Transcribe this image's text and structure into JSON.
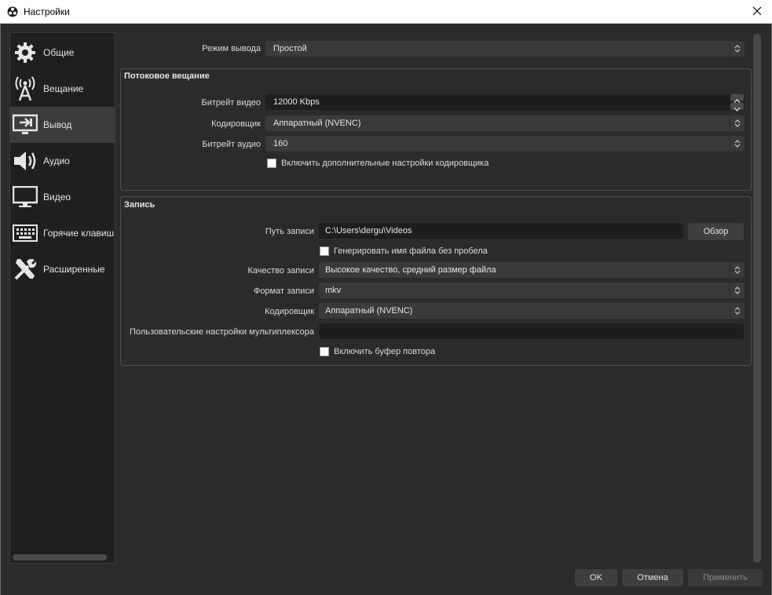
{
  "window": {
    "title": "Настройки"
  },
  "sidebar": {
    "items": [
      {
        "label": "Общие",
        "icon": "gear-icon"
      },
      {
        "label": "Вещание",
        "icon": "broadcast-icon"
      },
      {
        "label": "Вывод",
        "icon": "output-icon"
      },
      {
        "label": "Аудио",
        "icon": "speaker-icon"
      },
      {
        "label": "Видео",
        "icon": "monitor-icon"
      },
      {
        "label": "Горячие клавиш",
        "icon": "keyboard-icon"
      },
      {
        "label": "Расширенные",
        "icon": "tools-icon"
      }
    ],
    "active": "Вывод"
  },
  "output_mode": {
    "label": "Режим вывода",
    "value": "Простой"
  },
  "streaming": {
    "title": "Потоковое вещание",
    "video_bitrate": {
      "label": "Битрейт видео",
      "value": "12000 Kbps"
    },
    "encoder": {
      "label": "Кодировщик",
      "value": "Аппаратный (NVENC)"
    },
    "audio_bitrate": {
      "label": "Битрейт аудио",
      "value": "160"
    },
    "advanced_checkbox": {
      "label": "Включить дополнительные настройки кодировщика",
      "checked": false
    }
  },
  "recording": {
    "title": "Запись",
    "path": {
      "label": "Путь записи",
      "value": "C:\\Users\\dergu\\Videos"
    },
    "browse_button": "Обзор",
    "no_space_checkbox": {
      "label": "Генерировать имя файла без пробела",
      "checked": false
    },
    "quality": {
      "label": "Качество записи",
      "value": "Высокое качество, средний размер файла"
    },
    "format": {
      "label": "Формат записи",
      "value": "mkv"
    },
    "encoder": {
      "label": "Кодировщик",
      "value": "Аппаратный (NVENC)"
    },
    "muxer": {
      "label": "Пользовательские настройки мультиплексора",
      "value": ""
    },
    "replay_checkbox": {
      "label": "Включить буфер повтора",
      "checked": false
    }
  },
  "footer": {
    "ok": "OK",
    "cancel": "Отмена",
    "apply": "Применить"
  }
}
